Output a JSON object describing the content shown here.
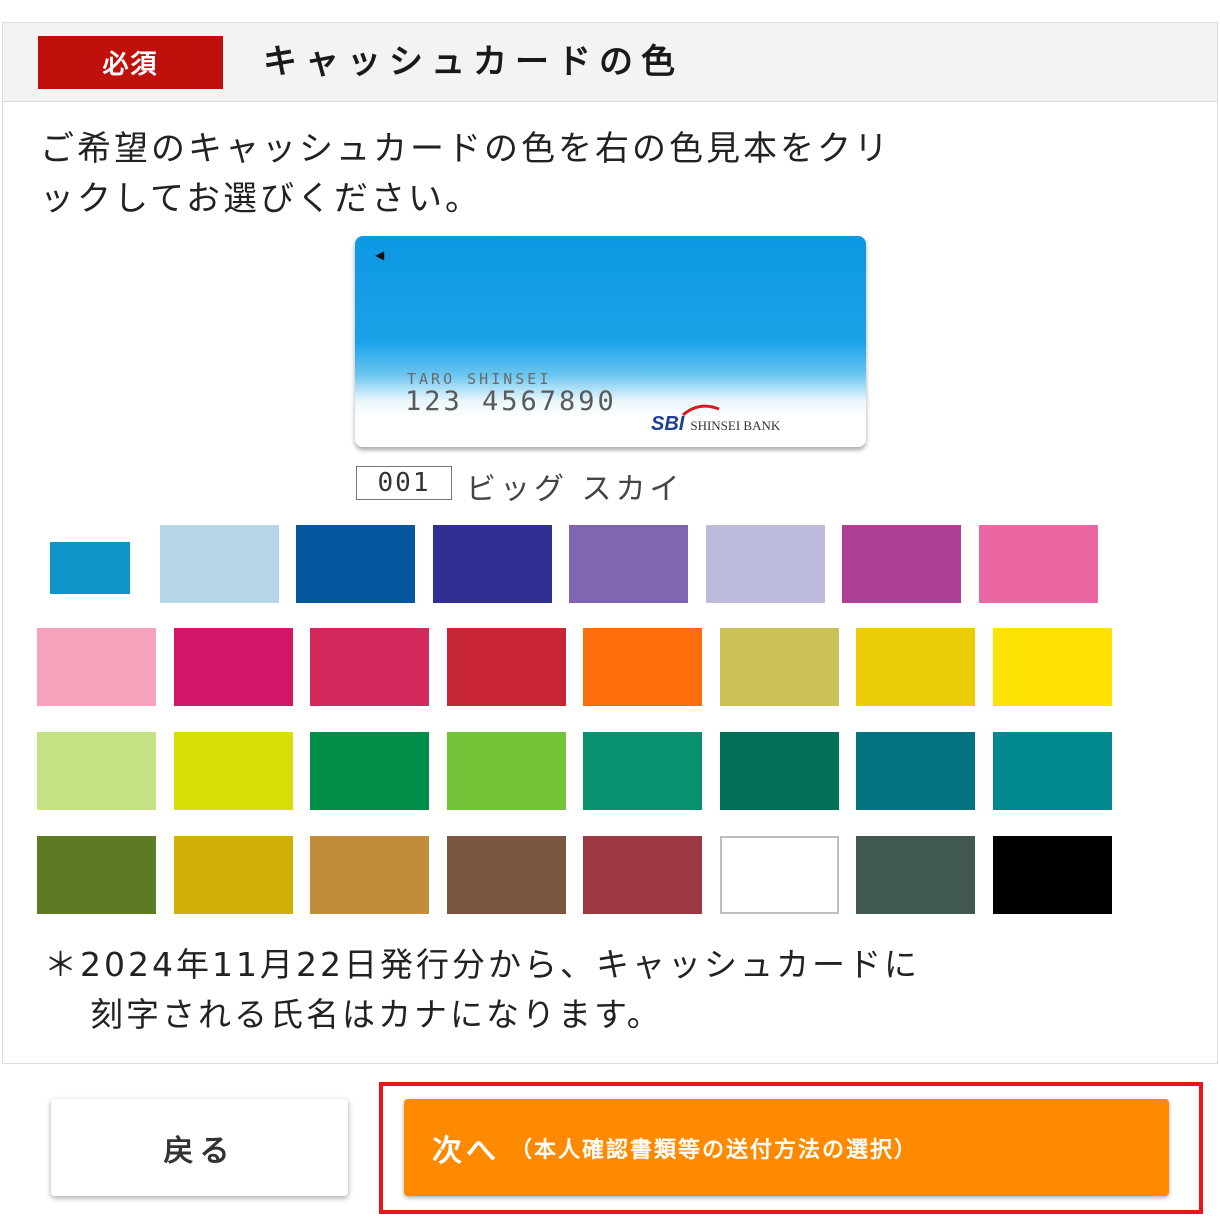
{
  "header": {
    "badge": "必須",
    "title": "キャッシュカードの色"
  },
  "instruction": {
    "line1": "ご希望のキャッシュカードの色を右の色見本をクリ",
    "line2": "ックしてお選びください。"
  },
  "card": {
    "holder_name": "TARO SHINSEI",
    "number": "123 4567890",
    "logo": "SBI",
    "bank_name": "SHINSEI BANK"
  },
  "selected_color": {
    "code": "001",
    "name": "ビッグ スカイ"
  },
  "swatch_colors": [
    [
      "#0e94c7",
      "#b7d5e8",
      "#03569c",
      "#312f93",
      "#8165b3",
      "#bbbadb",
      "#ad3f95",
      "#ea67a4"
    ],
    [
      "#f7a2bb",
      "#d21566",
      "#d2285c",
      "#c82634",
      "#fd6d0b",
      "#ccc156",
      "#ebcd05",
      "#fee203"
    ],
    [
      "#c4e183",
      "#d8df06",
      "#028e48",
      "#74c439",
      "#07916e",
      "#026f59",
      "#03717e",
      "#01898d"
    ],
    [
      "#5c7b22",
      "#d2b106",
      "#c28d3a",
      "#7b5741",
      "#9b3842",
      "#ffffff",
      "#415752",
      "#000000"
    ]
  ],
  "note": {
    "line1": "＊2024年11月22日発行分から、キャッシュカードに",
    "line2": "刻字される氏名はカナになります。"
  },
  "buttons": {
    "back": "戻る",
    "next": "次へ",
    "next_sub": "（本人確認書類等の送付方法の選択）"
  },
  "colors": {
    "badge_red": "#c0100c",
    "next_orange": "#ff8a00",
    "highlight_red": "#e8151b"
  }
}
